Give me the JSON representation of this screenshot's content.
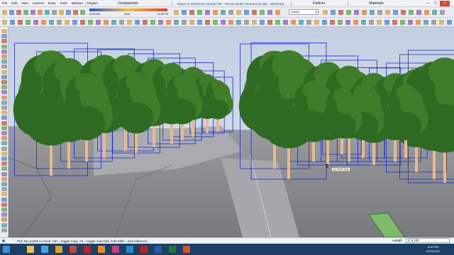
{
  "menubar": {
    "items": [
      "File",
      "Edit",
      "View",
      "Camera",
      "Draw",
      "Tools",
      "Window",
      "Plugins"
    ],
    "components_tab": "Components",
    "window_title": "Import to SketchUp Tutorial File - Terrain Model Cleaned Up.skp - SketchUp",
    "outliner_tab": "Outliner",
    "materials_tab": "Materials"
  },
  "toolbar": {
    "layer_select": "Layer0",
    "shadow_time_start": "06:43 AM",
    "shadow_time_noon": "Noon",
    "shadow_time_end": "04:46 PM"
  },
  "viewport": {
    "tooltip": "On Green Axis"
  },
  "statusbar": {
    "hint": "Pick two points to move.  Ctrl = toggle Copy, Alt = toggle Auto-fold, hold Shift = lock inference.",
    "measure_label": "Length",
    "measure_value": "2' 6 1/8\""
  },
  "taskbar": {
    "time": "8:20 PM",
    "date": "10/29/2012",
    "apps": [
      "start",
      "explorer",
      "ie",
      "chrome",
      "sketchup",
      "autocad",
      "illustrator",
      "indesign",
      "photoshop",
      "acrobat",
      "word",
      "excel",
      "powerpoint"
    ]
  },
  "colors": {
    "selection_box": "#1a2bd9",
    "tree_canopy": "#3f7d2a",
    "tree_trunk": "#e8b98a",
    "ground": "#8e9094",
    "sky": "#c9d4e2",
    "taskbar": "#1d3f63"
  }
}
